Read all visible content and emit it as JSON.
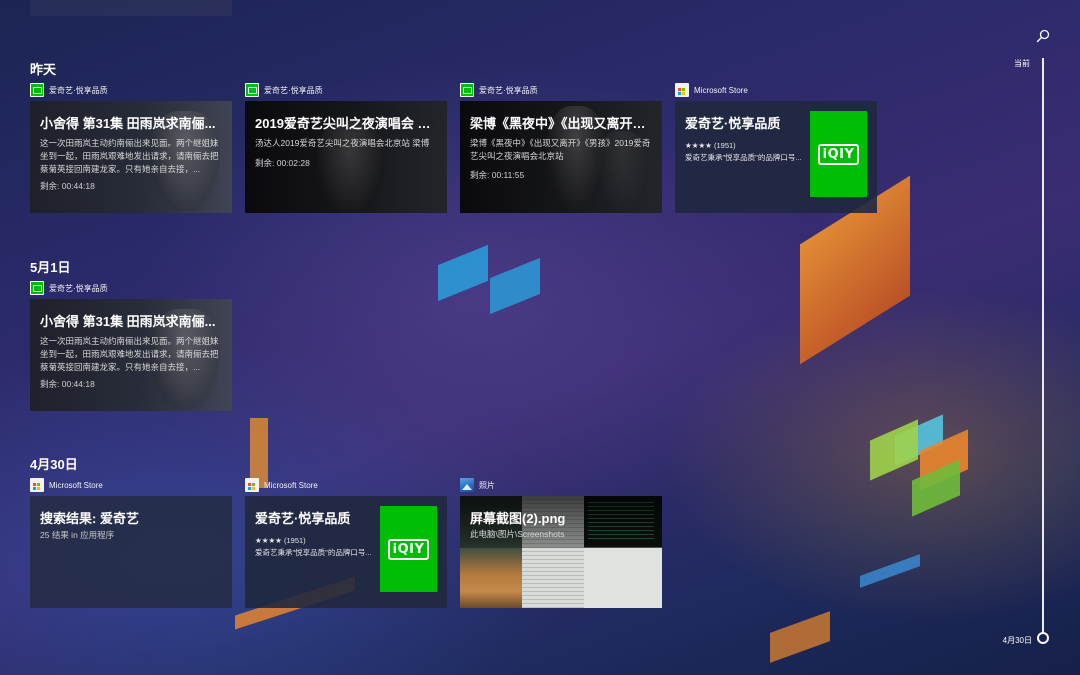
{
  "timeline": {
    "top_label": "当前",
    "bottom_label": "4月30日"
  },
  "sections": {
    "yesterday": "昨天",
    "may1": "5月1日",
    "apr30": "4月30日"
  },
  "cards": {
    "y1": {
      "source": "爱奇艺·悦享品质",
      "title": "小舍得 第31集 田雨岚求南俪...",
      "desc": "这一次田雨岚主动约南俪出来见面。两个继姐妹坐到一起，田雨岚艰难地发出请求，请南俪去把蔡菊英接回南建龙家。只有她亲自去接，...",
      "meta": "剩余: 00:44:18"
    },
    "y2": {
      "source": "爱奇艺·悦享品质",
      "title": "2019爱奇艺尖叫之夜演唱会 梁...",
      "desc": "汤达人2019爱奇艺尖叫之夜演唱会北京站 梁博",
      "meta": "剩余: 00:02:28"
    },
    "y3": {
      "source": "爱奇艺·悦享品质",
      "title": "梁博《黑夜中》《出现又离开》...",
      "desc": "梁博《黑夜中》《出现又离开》《男孩》2019爱奇艺尖叫之夜演唱会北京站",
      "meta": "剩余: 00:11:55"
    },
    "y4": {
      "source": "Microsoft Store",
      "title": "爱奇艺·悦享品质",
      "rating": "★★★★ (1951)",
      "desc": "爱奇艺秉承\"悦享品质\"的品牌口号...",
      "logo": "iQIY"
    },
    "m1": {
      "source": "爱奇艺·悦享品质",
      "title": "小舍得 第31集 田雨岚求南俪...",
      "desc": "这一次田雨岚主动约南俪出来见面。两个继姐妹坐到一起，田雨岚艰难地发出请求，请南俪去把蔡菊英接回南建龙家。只有她亲自去接，...",
      "meta": "剩余: 00:44:18"
    },
    "a1": {
      "source": "Microsoft Store",
      "title": "搜索结果: 爱奇艺",
      "sub": "25 结果 in 应用程序"
    },
    "a2": {
      "source": "Microsoft Store",
      "title": "爱奇艺·悦享品质",
      "rating": "★★★★ (1951)",
      "desc": "爱奇艺秉承\"悦享品质\"的品牌口号...",
      "logo": "iQIY"
    },
    "a3": {
      "source": "照片",
      "title": "屏幕截图(2).png",
      "path": "此电脑\\图片\\Screenshots"
    }
  },
  "colors": {
    "iqiyi_green": "#00be06",
    "accent_orange": "#f08a2a"
  }
}
